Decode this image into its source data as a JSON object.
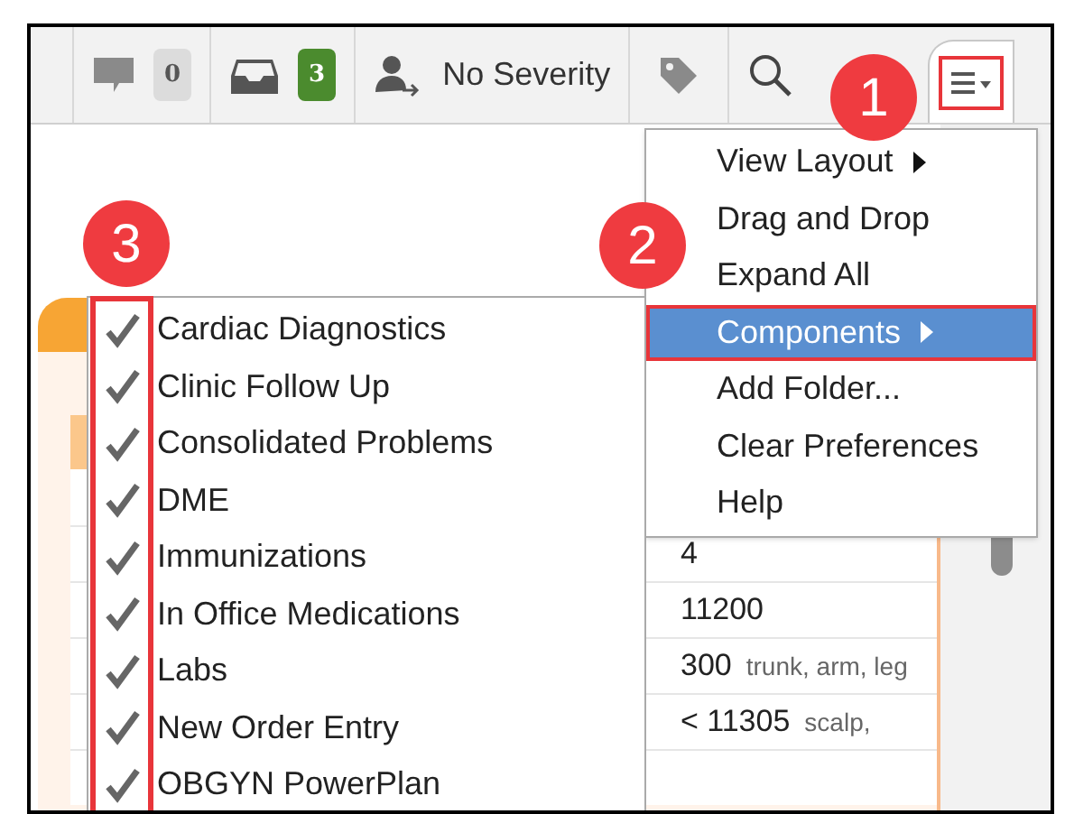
{
  "toolbar": {
    "comments_count": "0",
    "inbox_count": "3",
    "severity": "No Severity"
  },
  "menu": [
    {
      "label": "View Layout",
      "kind": "submenu",
      "selected": false
    },
    {
      "label": "Drag and Drop",
      "kind": "plain",
      "selected": false
    },
    {
      "label": "Expand All",
      "kind": "plain",
      "selected": false
    },
    {
      "label": "Components",
      "kind": "submenu",
      "selected": true
    },
    {
      "label": "Add Folder...",
      "kind": "plain",
      "selected": false
    },
    {
      "label": "Clear Preferences",
      "kind": "plain",
      "selected": false
    },
    {
      "label": "Help",
      "kind": "plain",
      "selected": false
    }
  ],
  "components": [
    {
      "label": "Cardiac Diagnostics",
      "checked": true
    },
    {
      "label": "Clinic Follow Up",
      "checked": true
    },
    {
      "label": "Consolidated Problems",
      "checked": true
    },
    {
      "label": "DME",
      "checked": true
    },
    {
      "label": "Immunizations",
      "checked": true
    },
    {
      "label": "In Office Medications",
      "checked": true
    },
    {
      "label": "Labs",
      "checked": true
    },
    {
      "label": "New Order Entry",
      "checked": true
    },
    {
      "label": "OBGYN PowerPlan",
      "checked": true
    }
  ],
  "card": {
    "rows": [
      {
        "column_2": "4"
      },
      {
        "column_2": "11200"
      },
      {
        "column_2": "300",
        "note": "trunk, arm, leg"
      },
      {
        "column_2": "< 11305",
        "note": "scalp,"
      }
    ]
  },
  "callouts": [
    "1",
    "2",
    "3"
  ]
}
